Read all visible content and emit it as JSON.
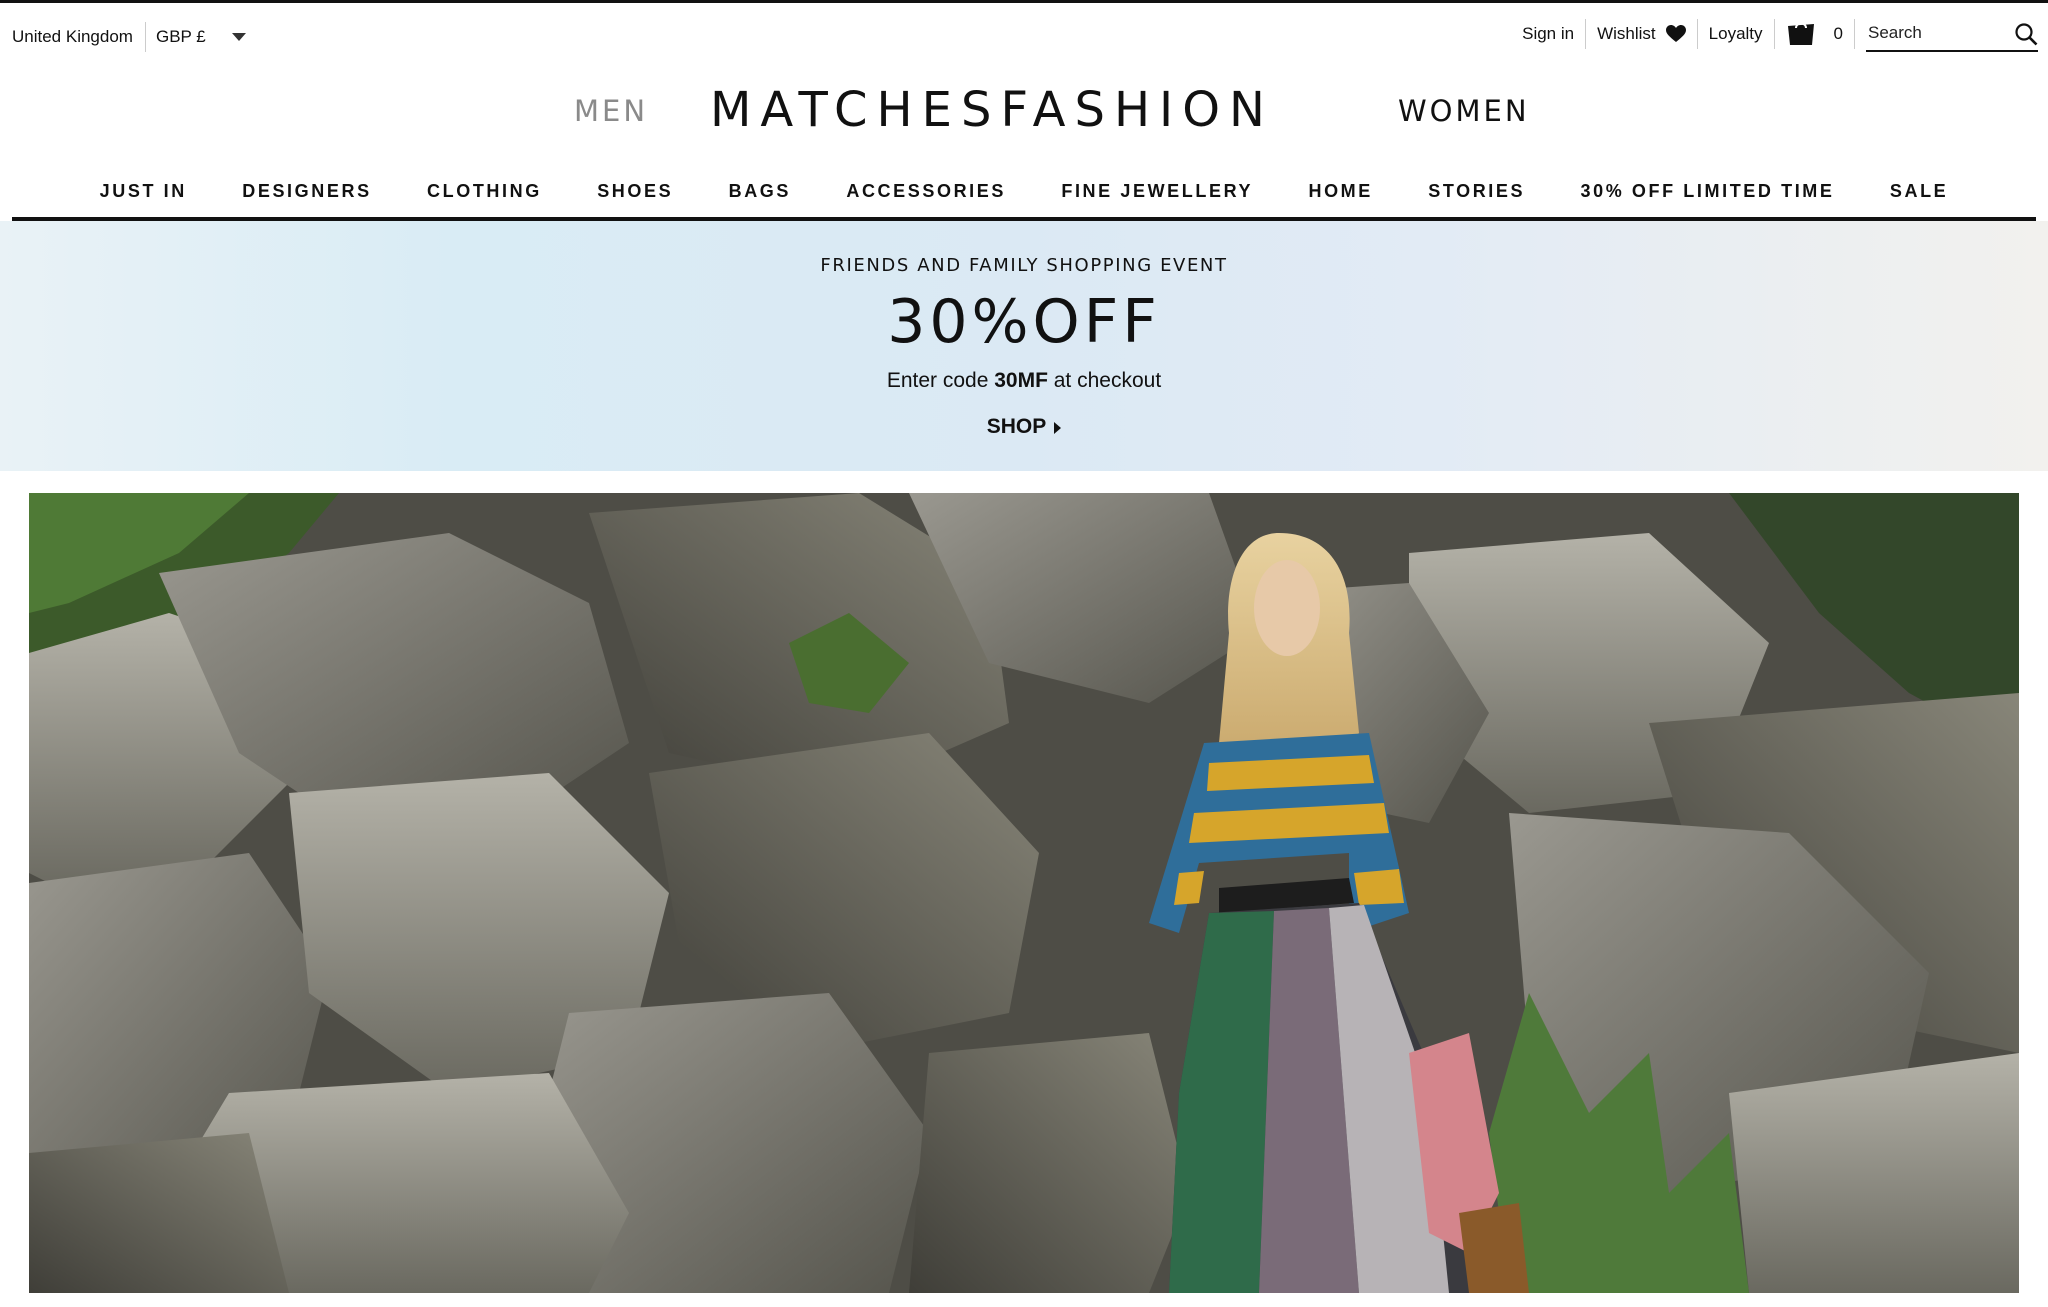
{
  "utility": {
    "country": "United Kingdom",
    "currency": "GBP £",
    "sign_in": "Sign in",
    "wishlist": "Wishlist",
    "loyalty": "Loyalty",
    "bag_count": "0",
    "search_placeholder": "Search"
  },
  "header": {
    "men": "MEN",
    "logo": "MATCHESFASHION",
    "women": "WOMEN"
  },
  "nav": {
    "items": [
      {
        "label": "JUST IN"
      },
      {
        "label": "DESIGNERS"
      },
      {
        "label": "CLOTHING"
      },
      {
        "label": "SHOES"
      },
      {
        "label": "BAGS"
      },
      {
        "label": "ACCESSORIES"
      },
      {
        "label": "FINE JEWELLERY"
      },
      {
        "label": "HOME"
      },
      {
        "label": "STORIES"
      },
      {
        "label": "30% OFF LIMITED TIME"
      },
      {
        "label": "SALE"
      }
    ]
  },
  "promo": {
    "kicker": "FRIENDS AND FAMILY SHOPPING EVENT",
    "headline": "30%OFF",
    "code_prefix": "Enter code ",
    "code": "30MF",
    "code_suffix": " at checkout",
    "cta": "SHOP"
  },
  "icons": {
    "wishlist": "heart-icon",
    "bag": "shopping-bag-icon",
    "search": "search-icon",
    "currency": "chevron-down-icon",
    "cta": "arrow-right-icon"
  }
}
